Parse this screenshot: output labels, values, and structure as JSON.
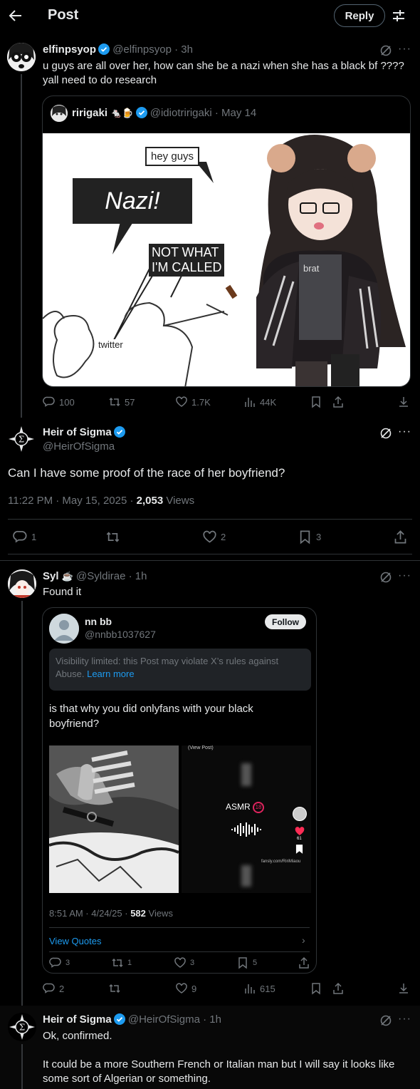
{
  "header": {
    "title": "Post",
    "reply_label": "Reply"
  },
  "post1": {
    "name": "elfinpsyop",
    "handle": "@elfinpsyop",
    "time": "· 3h",
    "text_line1": "u guys are all over her, how can she be a nazi when she has a black bf ????",
    "text_line2": "yall need to do research",
    "quote": {
      "name": "ririgaki",
      "emoji": "🐁🍺",
      "handle": "@idiotririgaki",
      "time": "· May 14",
      "meme_hey": "hey guys",
      "meme_nazi": "Nazi!",
      "meme_not_line1": "NOT WHAT",
      "meme_not_line2": "I'M CALLED",
      "meme_twitter": "twitter",
      "shirt_text": "brat"
    },
    "stats": {
      "replies": "100",
      "reposts": "57",
      "likes": "1.7K",
      "views": "44K"
    }
  },
  "main_post": {
    "name": "Heir of Sigma",
    "handle": "@HeirOfSigma",
    "text": "Can I have some proof of the race of her boyfriend?",
    "meta_time": "11:22 PM · May 15, 2025 · ",
    "meta_views_count": "2,053",
    "meta_views_label": " Views",
    "stats": {
      "replies": "1",
      "likes": "2",
      "bookmarks": "3"
    }
  },
  "reply1": {
    "name": "Syl",
    "emoji": "☕",
    "handle": "@Syldirae",
    "time": "· 1h",
    "text": "Found it",
    "screenshot": {
      "name": "nn bb",
      "handle": "@nnbb1037627",
      "follow": "Follow",
      "notice_text": "Visibility limited: this Post may violate X’s rules against Abuse. ",
      "notice_link": "Learn more",
      "text_line1": "is that why you did onlyfans with your black",
      "text_line2": "boyfriend?",
      "view_post": "(View Post)",
      "asmr": "ASMR",
      "age_badge": "18",
      "fansly": "fansly.com/RiriMiaou",
      "tt_count": "61",
      "meta_time": "8:51 AM · 4/24/25 · ",
      "meta_views_count": "582",
      "meta_views_label": " Views",
      "view_quotes": "View Quotes",
      "stats": {
        "replies": "3",
        "reposts": "1",
        "likes": "3",
        "bookmarks": "5"
      }
    },
    "stats": {
      "replies": "2",
      "likes": "9",
      "views": "615"
    }
  },
  "reply2": {
    "name": "Heir of Sigma",
    "handle": "@HeirOfSigma",
    "time": "· 1h",
    "text_line1": "Ok, confirmed.",
    "text_line2": "It could be a more Southern French or Italian man but I will say it looks like",
    "text_line3": "some sort of Algerian or something."
  },
  "colors": {
    "accent": "#1d9bf0",
    "background": "#000000",
    "muted": "#71767b",
    "border": "#2f3336"
  }
}
